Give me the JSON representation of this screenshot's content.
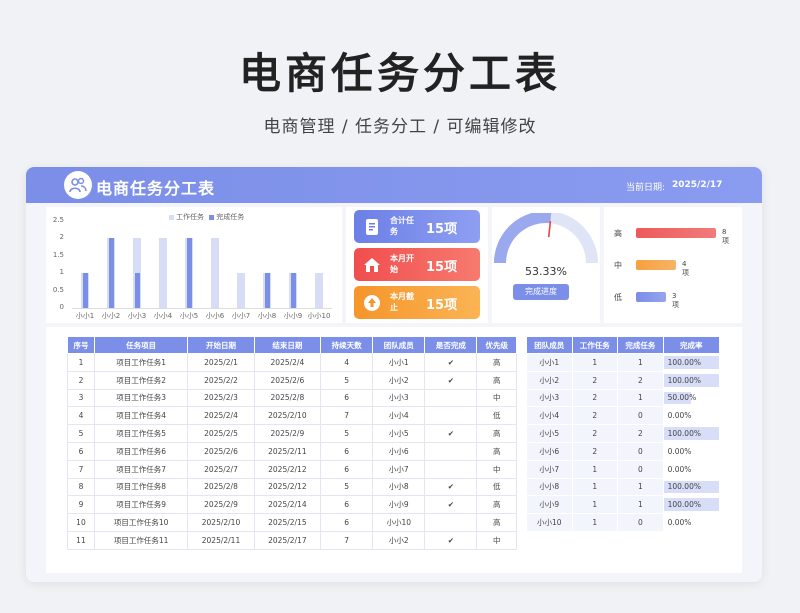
{
  "hero": {
    "title": "电商任务分工表",
    "subtitle": "电商管理 /  任务分工 /  可编辑修改"
  },
  "header": {
    "title": "电商任务分工表",
    "date_label": "当前日期:",
    "date_value": "2025/2/17"
  },
  "colors": {
    "accent": "#7b8ee8",
    "light_bar": "#d7dcf7",
    "dark_bar": "#7b8ee8"
  },
  "chart_data": {
    "type": "bar",
    "legend": [
      "工作任务",
      "完成任务"
    ],
    "categories": [
      "小小1",
      "小小2",
      "小小3",
      "小小4",
      "小小5",
      "小小6",
      "小小7",
      "小小8",
      "小小9",
      "小小10"
    ],
    "series": [
      {
        "name": "工作任务",
        "values": [
          1,
          2,
          2,
          2,
          2,
          2,
          1,
          1,
          1,
          1
        ]
      },
      {
        "name": "完成任务",
        "values": [
          1,
          2,
          1,
          0,
          2,
          0,
          0,
          1,
          1,
          0
        ]
      }
    ],
    "yticks": [
      "2.5",
      "2",
      "1.5",
      "1",
      "0.5",
      "0"
    ],
    "ylim": [
      0,
      2.5
    ]
  },
  "stats": [
    {
      "label": "合计任务",
      "value": "15项",
      "icon": "document-icon",
      "color_from": "#6c7fe6",
      "color_to": "#8e9ff2"
    },
    {
      "label": "本月开始",
      "value": "15项",
      "icon": "home-icon",
      "color_from": "#f04e4e",
      "color_to": "#f77a6e"
    },
    {
      "label": "本月截止",
      "value": "15项",
      "icon": "upload-icon",
      "color_from": "#f6952b",
      "color_to": "#fbb454"
    }
  ],
  "gauge": {
    "value": "53.33%",
    "fraction": 0.5333,
    "button": "完成进度"
  },
  "priority": [
    {
      "label": "高",
      "value": "8项",
      "count": 8,
      "color": "#ee5a5a"
    },
    {
      "label": "中",
      "value": "4项",
      "count": 4,
      "color": "#f6a040"
    },
    {
      "label": "低",
      "value": "3项",
      "count": 3,
      "color": "#7b8ee8"
    }
  ],
  "task_table": {
    "headers": [
      "序号",
      "任务项目",
      "开始日期",
      "结束日期",
      "持续天数",
      "团队成员",
      "是否完成",
      "优先级"
    ],
    "rows": [
      [
        "1",
        "项目工作任务1",
        "2025/2/1",
        "2025/2/4",
        "4",
        "小小1",
        "✔",
        "高"
      ],
      [
        "2",
        "项目工作任务2",
        "2025/2/2",
        "2025/2/6",
        "5",
        "小小2",
        "✔",
        "高"
      ],
      [
        "3",
        "项目工作任务3",
        "2025/2/3",
        "2025/2/8",
        "6",
        "小小3",
        "",
        "中"
      ],
      [
        "4",
        "项目工作任务4",
        "2025/2/4",
        "2025/2/10",
        "7",
        "小小4",
        "",
        "低"
      ],
      [
        "5",
        "项目工作任务5",
        "2025/2/5",
        "2025/2/9",
        "5",
        "小小5",
        "✔",
        "高"
      ],
      [
        "6",
        "项目工作任务6",
        "2025/2/6",
        "2025/2/11",
        "6",
        "小小6",
        "",
        "高"
      ],
      [
        "7",
        "项目工作任务7",
        "2025/2/7",
        "2025/2/12",
        "6",
        "小小7",
        "",
        "中"
      ],
      [
        "8",
        "项目工作任务8",
        "2025/2/8",
        "2025/2/12",
        "5",
        "小小8",
        "✔",
        "低"
      ],
      [
        "9",
        "项目工作任务9",
        "2025/2/9",
        "2025/2/14",
        "6",
        "小小9",
        "✔",
        "高"
      ],
      [
        "10",
        "项目工作任务10",
        "2025/2/10",
        "2025/2/15",
        "6",
        "小小10",
        "",
        "高"
      ],
      [
        "11",
        "项目工作任务11",
        "2025/2/11",
        "2025/2/17",
        "7",
        "小小2",
        "✔",
        "中"
      ]
    ]
  },
  "member_table": {
    "headers": [
      "团队成员",
      "工作任务",
      "完成任务",
      "完成率"
    ],
    "rows": [
      [
        "小小1",
        "1",
        "1",
        "100.00%"
      ],
      [
        "小小2",
        "2",
        "2",
        "100.00%"
      ],
      [
        "小小3",
        "2",
        "1",
        "50.00%"
      ],
      [
        "小小4",
        "2",
        "0",
        "0.00%"
      ],
      [
        "小小5",
        "2",
        "2",
        "100.00%"
      ],
      [
        "小小6",
        "2",
        "0",
        "0.00%"
      ],
      [
        "小小7",
        "1",
        "0",
        "0.00%"
      ],
      [
        "小小8",
        "1",
        "1",
        "100.00%"
      ],
      [
        "小小9",
        "1",
        "1",
        "100.00%"
      ],
      [
        "小小10",
        "1",
        "0",
        "0.00%"
      ]
    ],
    "rates": [
      1,
      1,
      0.5,
      0,
      1,
      0,
      0,
      1,
      1,
      0
    ]
  }
}
